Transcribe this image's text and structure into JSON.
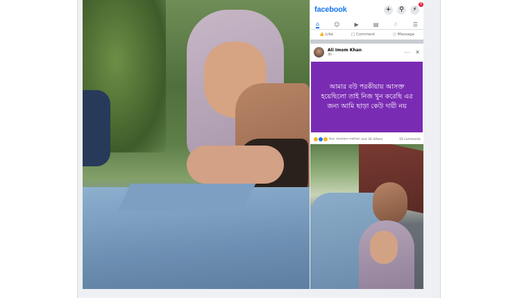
{
  "facebook": {
    "logo": "facebook",
    "tabs": [
      {
        "icon": "home-icon",
        "active": true
      },
      {
        "icon": "friends-icon",
        "active": false
      },
      {
        "icon": "video-icon",
        "active": false
      },
      {
        "icon": "marketplace-icon",
        "active": false
      },
      {
        "icon": "bell-icon",
        "active": false
      },
      {
        "icon": "menu-icon",
        "active": false
      }
    ],
    "actions": {
      "like": "Like",
      "comment": "Comment",
      "message": "Message"
    },
    "brand_color": "#1877f2"
  },
  "post": {
    "author": "Ali Imom Khan",
    "meta": "3h · ",
    "text": "আমার বউ পরকীয়ায় আসক্ত হয়েছিলো তাই নিজ খুন করেছি এর জন্য আমি ছাড়া কেউ দায়ী নয়",
    "background_color": "#7a2bb4",
    "reactions_text": "মিতা আরোমান সাকতিয়া and 34 others",
    "comments_text": "16 comments"
  }
}
